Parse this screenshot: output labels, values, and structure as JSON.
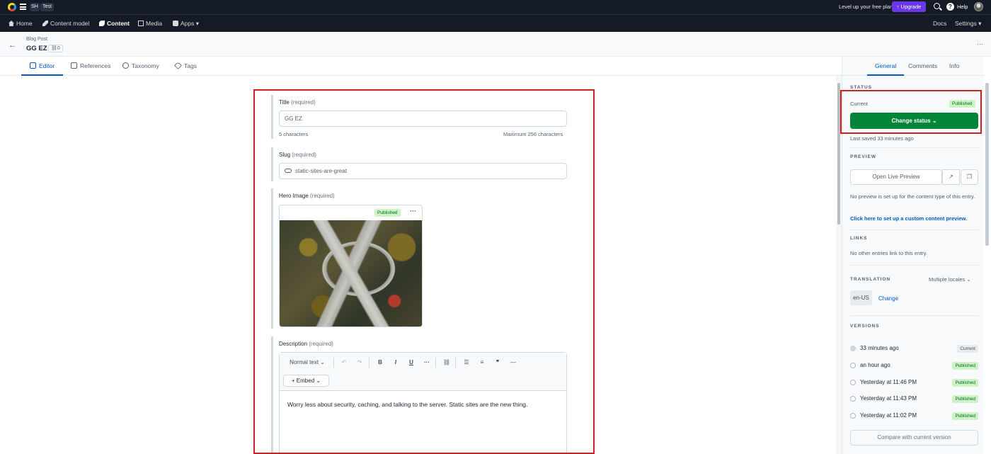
{
  "topbar": {
    "space_initials": "SH",
    "environment": "Test",
    "level_up": "Level up your free plan",
    "upgrade": "↑ Upgrade",
    "help": "Help"
  },
  "nav": {
    "home": "Home",
    "content_model": "Content model",
    "content": "Content",
    "media": "Media",
    "apps": "Apps ▾",
    "docs": "Docs",
    "settings": "Settings ▾"
  },
  "entry": {
    "content_type": "Blog Post",
    "title": "GG EZ",
    "references_count": "0"
  },
  "tabs": {
    "editor": "Editor",
    "references": "References",
    "taxonomy": "Taxonomy",
    "tags": "Tags"
  },
  "fields": {
    "title": {
      "label": "Title",
      "req": "(required)",
      "value": "GG EZ",
      "count": "5 characters",
      "max": "Maximum 256 characters"
    },
    "slug": {
      "label": "Slug",
      "req": "(required)",
      "value": "static-sites-are-great"
    },
    "hero": {
      "label": "Hero Image",
      "req": "(required)",
      "status": "Published",
      "more": "···"
    },
    "description": {
      "label": "Description",
      "req": "(required)",
      "format": "Normal text ⌄",
      "embed": "+ Embed ⌄",
      "body": "Worry less about security, caching, and talking to the server. Static sites are the new thing."
    }
  },
  "toolbar_glyphs": {
    "undo": "↶",
    "redo": "↷",
    "bold": "B",
    "italic": "I",
    "underline": "U",
    "more": "···",
    "link": "⛓",
    "ul": "☰",
    "ol": "≡",
    "quote": "❞",
    "hr": "—"
  },
  "sidebar": {
    "tabs": {
      "general": "General",
      "comments": "Comments",
      "info": "Info"
    },
    "status": {
      "heading": "STATUS",
      "current_label": "Current",
      "current_badge": "Published",
      "change_btn": "Change status ⌄",
      "last_saved": "Last saved 33 minutes ago"
    },
    "preview": {
      "heading": "PREVIEW",
      "open_btn": "Open Live Preview",
      "note": "No preview is set up for the content type of this entry.",
      "setup_link": "Click here to set up a custom content preview."
    },
    "links": {
      "heading": "LINKS",
      "note": "No other entries link to this entry."
    },
    "translation": {
      "heading": "TRANSLATION",
      "mode": "Multiple locales ⌄",
      "locale": "en-US",
      "change": "Change"
    },
    "versions": {
      "heading": "VERSIONS",
      "items": [
        {
          "time": "33 minutes ago",
          "badge": "Current"
        },
        {
          "time": "an hour ago",
          "badge": "Published"
        },
        {
          "time": "Yesterday at 11:46 PM",
          "badge": "Published"
        },
        {
          "time": "Yesterday at 11:43 PM",
          "badge": "Published"
        },
        {
          "time": "Yesterday at 11:02 PM",
          "badge": "Published"
        }
      ],
      "compare_btn": "Compare with current version"
    }
  },
  "colors": {
    "brand_blue": "#0059c8",
    "publish_green": "#008539",
    "highlight_red": "#d61f1f",
    "upgrade_purple": "#6a38e8"
  }
}
